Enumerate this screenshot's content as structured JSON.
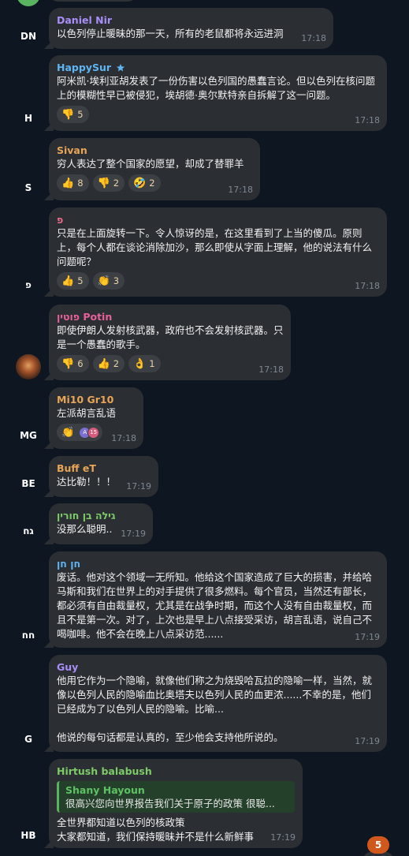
{
  "messages": [
    {
      "sender": "Daniel Nir",
      "sender_color": "#a88ef6",
      "avatar_text": "DN",
      "avatar_color": "#8d71e6",
      "text": "以色列停止暖昧的那一天，所有的老鼠都将永远进洞",
      "time": "17:18"
    },
    {
      "sender": "HappySur",
      "sender_color": "#5fb4f2",
      "sender_icon": "star-icon",
      "avatar_text": "H",
      "avatar_color": "#36a6e8",
      "text": "阿米凯·埃利亚胡发表了一份伤害以色列国的愚蠢言论。但以色列在核问题上的模糊性早已被侵犯，埃胡德·奥尔默特亲自拆解了这一问题。",
      "reactions": [
        {
          "emoji": "👎",
          "count": "5"
        }
      ],
      "time": "17:18"
    },
    {
      "sender": "Sivan",
      "sender_color": "#e9a557",
      "avatar_text": "S",
      "avatar_color": "#f08c37",
      "text": "穷人表达了整个国家的愿望，却成了替罪羊",
      "reactions": [
        {
          "emoji": "👍",
          "count": "8"
        },
        {
          "emoji": "👎",
          "count": "2"
        },
        {
          "emoji": "🤣",
          "count": "2"
        }
      ],
      "time": "17:18"
    },
    {
      "sender": "פ",
      "sender_color": "#ee6a8c",
      "avatar_text": "פ",
      "avatar_color": "#e2557e",
      "text": "只是在上面旋转一下。令人惊讶的是，在这里看到了上当的傻瓜。原则上，每个人都在谈论消除加沙，那么即使从字面上理解，他的说法有什么问题呢？",
      "reactions": [
        {
          "emoji": "👍",
          "count": "5"
        },
        {
          "emoji": "👏",
          "count": "3"
        }
      ],
      "time": "17:18"
    },
    {
      "sender": "פוטין Potin",
      "sender_color": "#e6609a",
      "avatar_text": "",
      "avatar_icon": "mushroom-cloud-icon",
      "avatar_color": "#6b3b22",
      "text": "即使伊朗人发射核武器，政府也不会发射核武器。只是一个愚蠢的歌手。",
      "reactions": [
        {
          "emoji": "👎",
          "count": "6"
        },
        {
          "emoji": "👍",
          "count": "2"
        },
        {
          "emoji": "👌",
          "count": "1"
        }
      ],
      "time": "17:18"
    },
    {
      "sender": "Mi10 Gr10",
      "sender_color": "#e9a557",
      "avatar_text": "MG",
      "avatar_color": "#f08c37",
      "text": "左派胡言乱语",
      "reaction_clap": {
        "emoji": "👏",
        "avatars": [
          {
            "text": "A",
            "color": "#7b6fd6"
          },
          {
            "text": "15",
            "color": "#d85a7c"
          }
        ]
      },
      "time": "17:18"
    },
    {
      "sender": "Buff eT",
      "sender_color": "#e9a557",
      "avatar_text": "BE",
      "avatar_color": "#f08c37",
      "text": "达比勒！！！",
      "time": "17:19"
    },
    {
      "sender": "גילה בן חורין",
      "sender_color": "#7dcb67",
      "avatar_text": "גח",
      "avatar_color": "#5ab35e",
      "text": "没那么聪明..",
      "time": "17:19"
    },
    {
      "sender": "חן חן",
      "sender_color": "#5fb4f2",
      "avatar_text": "חח",
      "avatar_color": "#36a6e8",
      "text": "废话。他对这个领域一无所知。他给这个国家造成了巨大的损害，并给哈马斯和我们在世界上的对手提供了很多燃料。每个官员，当然还有部长，都必须有自由裁量权，尤其是在战争时期，而这个人没有自由裁量权，而且不是第一次。对了，上次也是早上八点接受采访，胡言乱语，说自己不喝咖啡。他不会在晚上八点采访范......",
      "time": "17:19"
    },
    {
      "sender": "Guy",
      "sender_color": "#a88ef6",
      "avatar_text": "G",
      "avatar_color": "#8d71e6",
      "text": "他用它作为一个隐喻，就像他们称之为烧毁哈瓦拉的隐喻一样，当然，就像以色列人民的隐喻血比奥塔夫以色列人民的血更浓......不幸的是，他们已经成为了以色列人民的隐喻。比喻...\n\n他说的每句话都是认真的，至少他会支持他所说的。",
      "time": "17:19"
    },
    {
      "sender": "Hirtush balabush",
      "sender_color": "#7dcb67",
      "avatar_text": "HB",
      "avatar_color": "#5ab35e",
      "reply": {
        "name": "Shany Hayoun",
        "text": "很高兴您向世界报告我们关于原子的政策 很聪..."
      },
      "text": "全世界都知道以色列的核政策\n大家都知道，我们保持暖昧并不是什么新鲜事",
      "time": "17:19"
    }
  ],
  "unread_count": "5"
}
